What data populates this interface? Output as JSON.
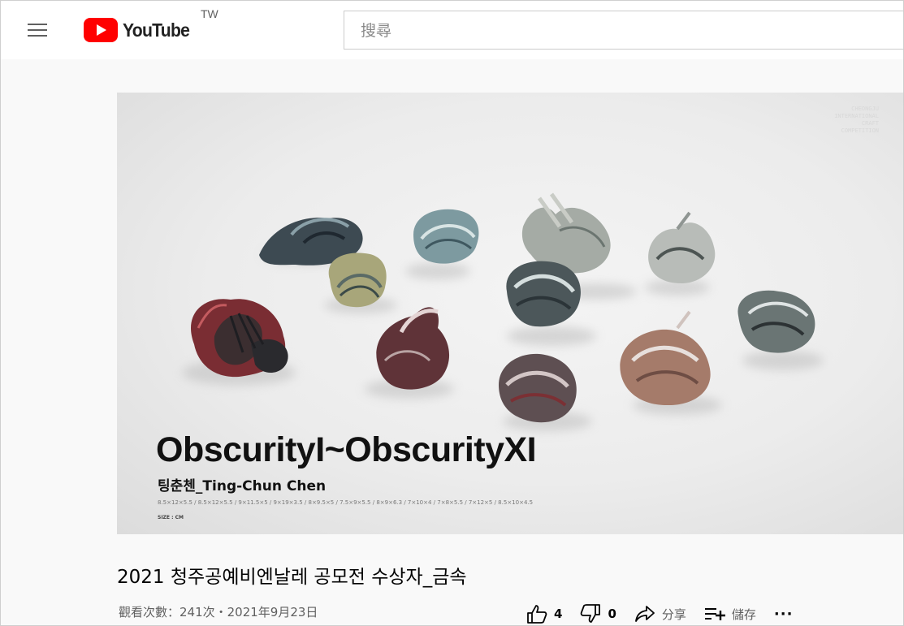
{
  "header": {
    "logo_text": "YouTube",
    "region": "TW",
    "search_placeholder": "搜尋"
  },
  "video": {
    "watermark": [
      "CHEONGJU",
      "INTERNATIONAL",
      "CRAFT",
      "COMPETITION"
    ],
    "overlay_title": "ObscurityI~ObscurityXI",
    "overlay_artist": "팅춘첸_Ting-Chun Chen",
    "overlay_dimensions": "8.5×12×5.5 / 8.5×12×5.5 / 9×11.5×5 / 9×19×3.5 / 8×9.5×5 / 7.5×9×5.5 / 8×9×6.3 / 7×10×4 / 7×8×5.5 / 7×12×5 / 8.5×10×4.5",
    "overlay_size_unit": "SIZE : CM",
    "title": "2021 청주공예비엔날레 공모전 수상자_금속",
    "views_date": "觀看次數：241次・2021年9月23日"
  },
  "actions": {
    "like_count": "4",
    "dislike_count": "0",
    "share_label": "分享",
    "save_label": "儲存",
    "more_label": "···"
  },
  "colors": {
    "brand_red": "#ff0000",
    "text_primary": "#030303",
    "text_secondary": "#606060"
  }
}
